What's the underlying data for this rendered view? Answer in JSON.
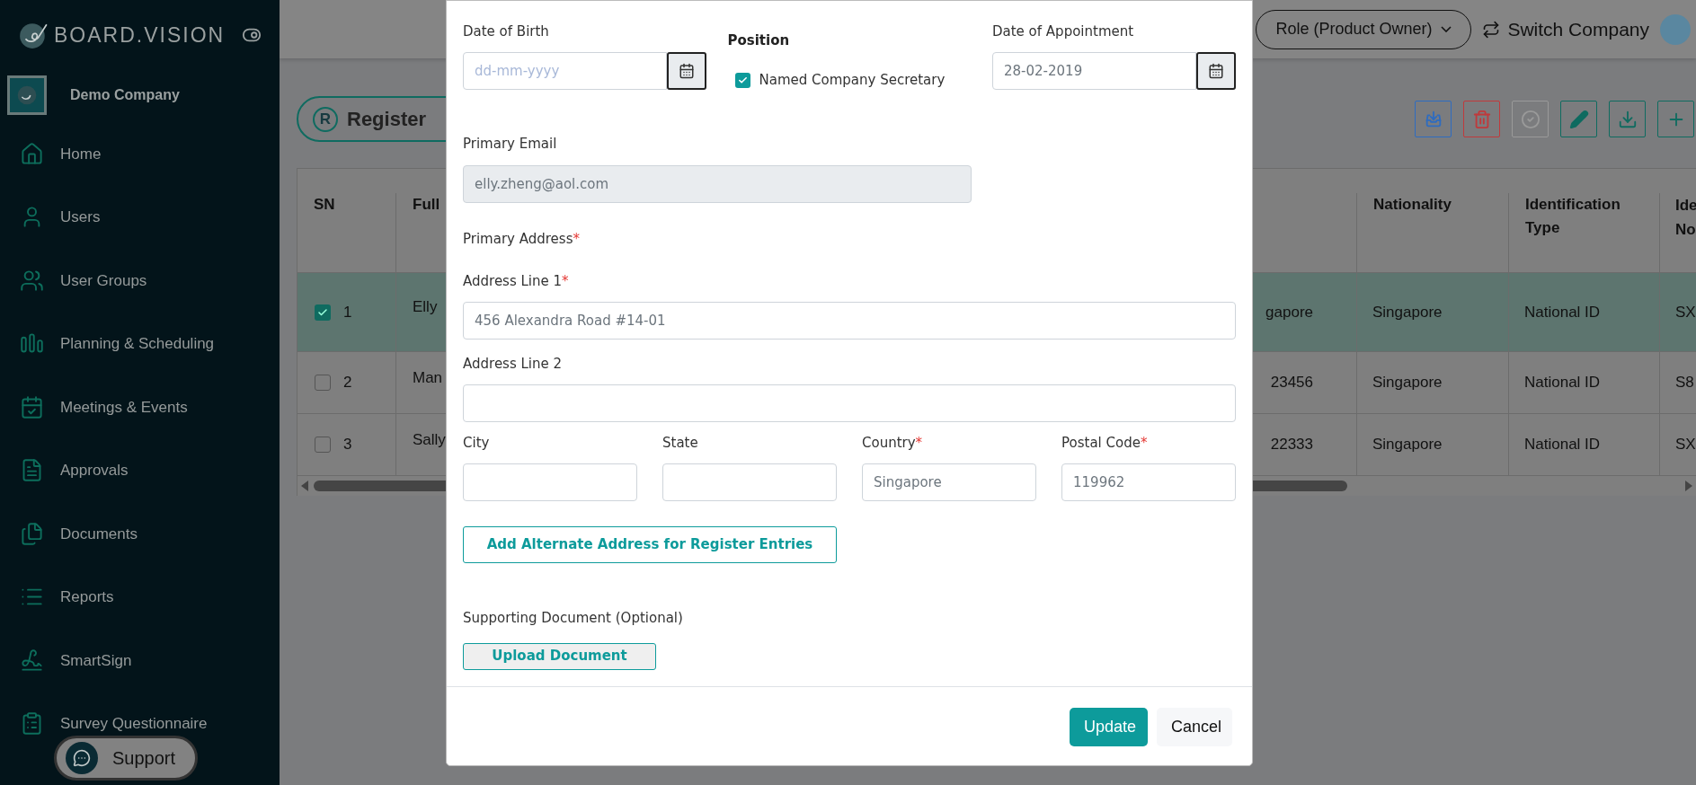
{
  "sidebar": {
    "brand": "BOARD.VISION",
    "company": "Demo Company",
    "items": [
      {
        "label": "Home",
        "selected": false
      },
      {
        "label": "Users",
        "selected": false
      },
      {
        "label": "User Groups",
        "selected": false
      },
      {
        "label": "Planning & Scheduling",
        "selected": false
      },
      {
        "label": "Meetings & Events",
        "selected": false
      },
      {
        "label": "Approvals",
        "selected": false
      },
      {
        "label": "Documents",
        "selected": false
      },
      {
        "label": "Reports",
        "selected": false
      },
      {
        "label": "SmartSign",
        "selected": false
      },
      {
        "label": "Survey Questionnaire",
        "selected": false
      }
    ],
    "support": "Support"
  },
  "header": {
    "role": "Role (Product Owner)",
    "switch_company": "Switch Company"
  },
  "page": {
    "badge": "R",
    "title": "Register",
    "toolbar": [
      {
        "kind": "import",
        "color": "#2e6cc0"
      },
      {
        "kind": "delete",
        "color": "#c0393b"
      },
      {
        "kind": "approve",
        "color": "#9a9a9a"
      },
      {
        "kind": "edit",
        "color": "#0f6b60"
      },
      {
        "kind": "download",
        "color": "#0f6b60"
      },
      {
        "kind": "add",
        "color": "#0f6b60"
      }
    ]
  },
  "table": {
    "columns": {
      "sn": "SN",
      "name": "Full",
      "nationality": "Nationality",
      "id_type": "Identification Type",
      "id_no": "Ide No"
    },
    "rows": [
      {
        "selected": true,
        "checked": true,
        "sn": "1",
        "name": "Elly",
        "column_4": "gapore",
        "nationality": "Singapore",
        "id_type": "National ID",
        "id_no": "SX"
      },
      {
        "selected": false,
        "checked": false,
        "sn": "2",
        "name": "Man",
        "column_4": "23456",
        "nationality": "Singapore",
        "id_type": "National ID",
        "id_no": "S8"
      },
      {
        "selected": false,
        "checked": false,
        "sn": "3",
        "name": "Sally",
        "column_4": "22333",
        "nationality": "Singapore",
        "id_type": "National ID",
        "id_no": "SX"
      }
    ]
  },
  "modal": {
    "date_of_birth": {
      "label": "Date of Birth",
      "placeholder": "dd-mm-yyyy"
    },
    "position": {
      "label": "Position",
      "options": [
        {
          "label": "Named Company Secretary",
          "checked": true
        }
      ]
    },
    "date_of_appointment": {
      "label": "Date of Appointment",
      "value": "28-02-2019"
    },
    "primary_email": {
      "label": "Primary Email",
      "value": "elly.zheng@aol.com",
      "disabled": true
    },
    "primary_address": {
      "label": "Primary Address",
      "mark": "*"
    },
    "address_lines": [
      {
        "label": "Address Line 1",
        "mark": "*",
        "value": "456 Alexandra Road #14-01"
      },
      {
        "label": "Address Line 2"
      }
    ],
    "location_fields": [
      {
        "label": "City"
      },
      {
        "label": "State"
      },
      {
        "label": "Country",
        "mark": "*",
        "value": "Singapore"
      },
      {
        "label": "Postal Code",
        "mark": "*",
        "value": "119962"
      }
    ],
    "alternate_address_button": "Add Alternate Address for Register Entries",
    "supporting_document": {
      "label": "Supporting Document (Optional)",
      "button": "Upload Document"
    },
    "footer": [
      {
        "label": "Update",
        "kind": "primary"
      },
      {
        "label": "Cancel",
        "kind": "secondary"
      }
    ]
  }
}
